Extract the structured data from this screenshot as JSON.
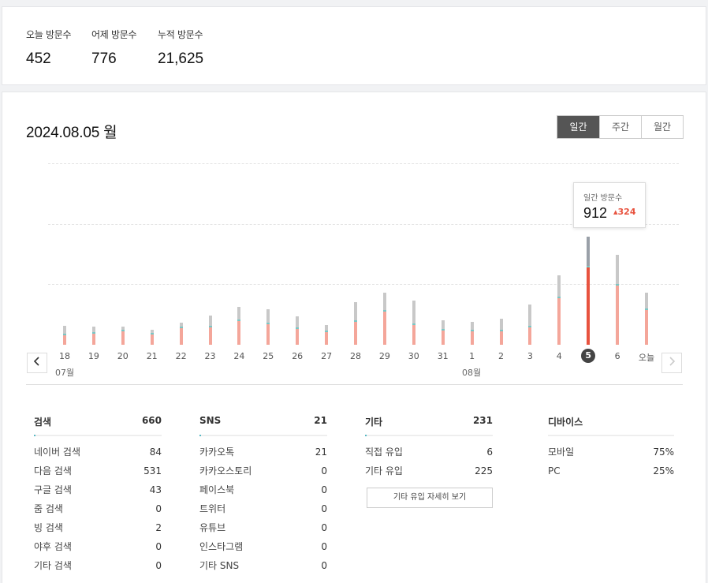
{
  "summary": {
    "today": {
      "label": "오늘 방문수",
      "value": "452"
    },
    "yesterday": {
      "label": "어제 방문수",
      "value": "776"
    },
    "total": {
      "label": "누적 방문수",
      "value": "21,625"
    }
  },
  "date_title": "2024.08.05 월",
  "period_tabs": [
    "일간",
    "주간",
    "월간"
  ],
  "active_tab": "일간",
  "tooltip": {
    "label": "일간 방문수",
    "value": "912",
    "delta": "324",
    "delta_icon": "caret-up-icon"
  },
  "colors": {
    "bar_main": "#f4a69a",
    "bar_selected": "#e8533f",
    "bar_other": "#c8c8c8",
    "accent_teal": "#79c7c5",
    "tab_active": "#555555"
  },
  "nav": {
    "prev_icon": "chevron-left-icon",
    "next_icon": "chevron-right-icon"
  },
  "chart_data": {
    "type": "bar",
    "categories": [
      "18",
      "19",
      "20",
      "21",
      "22",
      "23",
      "24",
      "25",
      "26",
      "27",
      "28",
      "29",
      "30",
      "31",
      "1",
      "2",
      "3",
      "4",
      "5",
      "6",
      "오늘"
    ],
    "month_labels": [
      {
        "text": "07월",
        "at": "18"
      },
      {
        "text": "08월",
        "at": "1"
      }
    ],
    "selected": "5",
    "series": [
      {
        "values": [
          85,
          100,
          120,
          95,
          145,
          155,
          205,
          180,
          140,
          115,
          200,
          285,
          175,
          125,
          120,
          120,
          150,
          395,
          658,
          500,
          296
        ]
      },
      {
        "values": [
          75,
          50,
          35,
          30,
          40,
          90,
          115,
          120,
          100,
          50,
          155,
          150,
          195,
          80,
          75,
          100,
          190,
          185,
          252,
          255,
          140
        ]
      }
    ],
    "grid": true
  },
  "tables": {
    "search": {
      "title": "검색",
      "total": "660",
      "rows": [
        [
          "네이버 검색",
          "84"
        ],
        [
          "다음 검색",
          "531"
        ],
        [
          "구글 검색",
          "43"
        ],
        [
          "줌 검색",
          "0"
        ],
        [
          "빙 검색",
          "2"
        ],
        [
          "야후 검색",
          "0"
        ],
        [
          "기타 검색",
          "0"
        ]
      ]
    },
    "sns": {
      "title": "SNS",
      "total": "21",
      "rows": [
        [
          "카카오톡",
          "21"
        ],
        [
          "카카오스토리",
          "0"
        ],
        [
          "페이스북",
          "0"
        ],
        [
          "트위터",
          "0"
        ],
        [
          "유튜브",
          "0"
        ],
        [
          "인스타그램",
          "0"
        ],
        [
          "기타 SNS",
          "0"
        ]
      ]
    },
    "etc": {
      "title": "기타",
      "total": "231",
      "rows": [
        [
          "직접 유입",
          "6"
        ],
        [
          "기타 유입",
          "225"
        ]
      ],
      "more_button": "기타 유입 자세히 보기"
    },
    "device": {
      "title": "디바이스",
      "total": "",
      "rows": [
        [
          "모바일",
          "75%"
        ],
        [
          "PC",
          "25%"
        ]
      ]
    }
  }
}
